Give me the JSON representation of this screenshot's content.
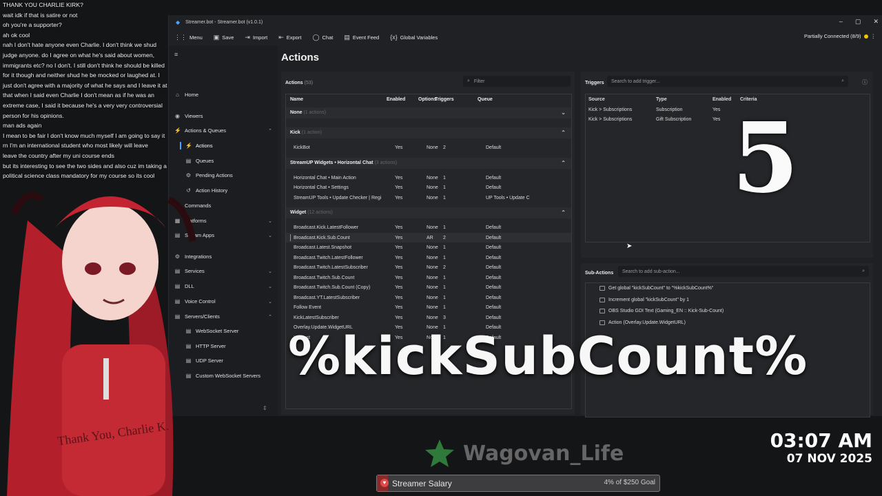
{
  "chat": [
    "THANK YOU CHARLIE KIRK?",
    "wait idk if that is satire or not",
    "oh you're a supporter?",
    "ah ok cool",
    "nah I don't hate anyone even Charlie. I don't think we shud judge anyone. do I agree on what he's said about women, immigrants etc? no I don't. I still don't think he should be killed for it though and neither shud he be mocked or laughed at. I just don't agree with a majority of what he says and I leave it at that when I said even Charlie I don't mean as if he was an extreme case, I said it because he's a very very controversial person for his opinions.",
    "man ads again",
    "I mean to be fair I don't know much myself I am going to say it rn I'm an international student who most likely will leave",
    "leave the country after my uni course ends",
    "but its interesting to see the two sides and also cuz im taking a political science class mandatory for my course so its cool"
  ],
  "window": {
    "title": "Streamer.bot - Streamer.bot (v1.0.1)",
    "status": "Partially Connected (8/9)"
  },
  "menu": [
    {
      "icon": "grid-icon",
      "glyph": "⋮⋮",
      "label": "Menu"
    },
    {
      "icon": "save-icon",
      "glyph": "▣",
      "label": "Save"
    },
    {
      "icon": "import-icon",
      "glyph": "⇥",
      "label": "Import"
    },
    {
      "icon": "export-icon",
      "glyph": "⇤",
      "label": "Export"
    },
    {
      "icon": "chat-icon",
      "glyph": "◯",
      "label": "Chat"
    },
    {
      "icon": "event-feed-icon",
      "glyph": "▤",
      "label": "Event Feed"
    },
    {
      "icon": "variables-icon",
      "glyph": "{x}",
      "label": "Global Variables"
    }
  ],
  "sidebar": [
    {
      "label": "Home",
      "glyph": "⌂",
      "sub": false,
      "chev": ""
    },
    {
      "label": "Viewers",
      "glyph": "◉",
      "sub": false,
      "chev": ""
    },
    {
      "label": "Actions & Queues",
      "glyph": "⚡",
      "sub": false,
      "chev": "⌃"
    },
    {
      "label": "Actions",
      "glyph": "⚡",
      "sub": true,
      "chev": "",
      "active": true
    },
    {
      "label": "Queues",
      "glyph": "▤",
      "sub": true,
      "chev": ""
    },
    {
      "label": "Pending Actions",
      "glyph": "⚙",
      "sub": true,
      "chev": ""
    },
    {
      "label": "Action History",
      "glyph": "↺",
      "sub": true,
      "chev": ""
    },
    {
      "label": "Commands",
      "glyph": "⌘",
      "sub": false,
      "chev": ""
    },
    {
      "label": "Platforms",
      "glyph": "▦",
      "sub": false,
      "chev": "⌄"
    },
    {
      "label": "Stream Apps",
      "glyph": "▤",
      "sub": false,
      "chev": "⌄"
    },
    {
      "label": "Integrations",
      "glyph": "⚙",
      "sub": false,
      "chev": ""
    },
    {
      "label": "Services",
      "glyph": "▤",
      "sub": false,
      "chev": "⌄"
    },
    {
      "label": "DLL",
      "glyph": "▤",
      "sub": false,
      "chev": "⌄"
    },
    {
      "label": "Voice Control",
      "glyph": "▤",
      "sub": false,
      "chev": "⌄"
    },
    {
      "label": "Servers/Clients",
      "glyph": "▤",
      "sub": false,
      "chev": "⌃"
    },
    {
      "label": "WebSocket Server",
      "glyph": "▤",
      "sub": true,
      "chev": ""
    },
    {
      "label": "HTTP Server",
      "glyph": "▤",
      "sub": true,
      "chev": ""
    },
    {
      "label": "UDP Server",
      "glyph": "▤",
      "sub": true,
      "chev": ""
    },
    {
      "label": "Custom WebSocket Servers",
      "glyph": "▤",
      "sub": true,
      "chev": ""
    }
  ],
  "actions": {
    "page_title": "Actions",
    "panel_title": "Actions",
    "count": "(53)",
    "filter_placeholder": "Filter",
    "columns": [
      "Name",
      "Enabled",
      "Options",
      "Triggers",
      "Queue"
    ],
    "groups": [
      {
        "name": "None",
        "count": "(1 actions)",
        "chev": "⌄",
        "rows": []
      },
      {
        "name": "Kick",
        "count": "(1 action)",
        "chev": "⌃",
        "rows": [
          [
            "KickBot",
            "Yes",
            "None",
            "2",
            "Default"
          ]
        ]
      },
      {
        "name": "StreamUP Widgets • Horizontal Chat",
        "count": "(3 actions)",
        "chev": "⌃",
        "rows": [
          [
            "Horizontal Chat • Main Action",
            "Yes",
            "None",
            "1",
            "Default"
          ],
          [
            "Horizontal Chat • Settings",
            "Yes",
            "None",
            "1",
            "Default"
          ],
          [
            "StreamUP Tools • Update Checker | Regi",
            "Yes",
            "None",
            "1",
            "UP Tools • Update C"
          ]
        ]
      },
      {
        "name": "Widget",
        "count": "(12 actions)",
        "chev": "⌃",
        "rows": [
          [
            "Broadcast.Kick.LatestFollower",
            "Yes",
            "None",
            "1",
            "Default"
          ],
          [
            "Broadcast.Kick.Sub.Count",
            "Yes",
            "AR",
            "2",
            "Default"
          ],
          [
            "Broadcast.Latest.Snapshot",
            "Yes",
            "None",
            "1",
            "Default"
          ],
          [
            "Broadcast.Twitch.LatestFollower",
            "Yes",
            "None",
            "1",
            "Default"
          ],
          [
            "Broadcast.Twitch.LatestSubscriber",
            "Yes",
            "None",
            "2",
            "Default"
          ],
          [
            "Broadcast.Twitch.Sub.Count",
            "Yes",
            "None",
            "1",
            "Default"
          ],
          [
            "Broadcast.Twitch.Sub.Count (Copy)",
            "Yes",
            "None",
            "1",
            "Default"
          ],
          [
            "Broadcast.YT.LatestSubscriber",
            "Yes",
            "None",
            "1",
            "Default"
          ],
          [
            "Follow Event",
            "Yes",
            "None",
            "1",
            "Default"
          ],
          [
            "KickLatestSubscriber",
            "Yes",
            "None",
            "3",
            "Default"
          ],
          [
            "Overlay.Update.WidgetURL",
            "Yes",
            "None",
            "1",
            "Default"
          ],
          [
            "YT_test",
            "Yes",
            "None",
            "1",
            "Default"
          ]
        ]
      }
    ]
  },
  "triggers": {
    "title": "Triggers",
    "search_placeholder": "Search to add trigger...",
    "columns": [
      "Source",
      "Type",
      "Enabled",
      "Criteria"
    ],
    "rows": [
      [
        "Kick > Subscriptions",
        "Subscription",
        "Yes",
        ""
      ],
      [
        "Kick > Subscriptions",
        "Gift Subscription",
        "Yes",
        ""
      ]
    ]
  },
  "subactions": {
    "title": "Sub-Actions",
    "search_placeholder": "Search to add sub-action...",
    "items": [
      "Get global \"kickSubCount\" to \"%kickSubCount%\"",
      "Increment global \"kickSubCount\" by 1",
      "OBS Studio GDI Text (Gaming_EN :: Kick-Sub-Count)",
      "Action (Overlay.Update.WidgetURL)"
    ]
  },
  "overlay": {
    "big_number": "5",
    "big_variable": "%kickSubCount%",
    "brand": "Wagovan_Life",
    "time": "03:07 AM",
    "date": "07 NOV 2025",
    "goal_label": "Streamer Salary",
    "goal_amount": "4% of $250 Goal",
    "goal_progress": 0.04,
    "shirt_text": "Thank You, Charlie K."
  },
  "colors": {
    "accent": "#4da3ff",
    "status": "#f2c500",
    "goal": "#e24a4a"
  }
}
